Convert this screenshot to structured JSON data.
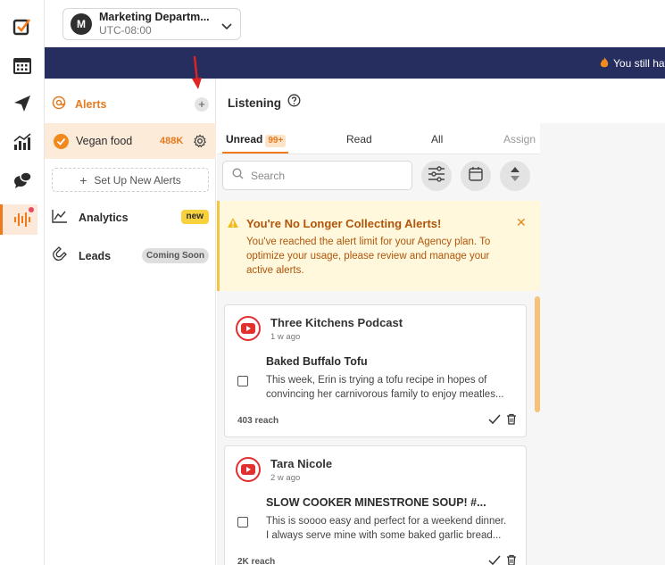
{
  "workspace": {
    "avatar": "M",
    "name": "Marketing Departm...",
    "timezone": "UTC-08:00"
  },
  "banner": {
    "text": "You still hav"
  },
  "sidebar": {
    "alerts_label": "Alerts",
    "alert_item": {
      "label": "Vegan food",
      "count": "488K"
    },
    "setup_label": "Set Up New Alerts",
    "analytics_label": "Analytics",
    "analytics_badge": "new",
    "leads_label": "Leads",
    "leads_badge": "Coming Soon"
  },
  "listening": {
    "title": "Listening"
  },
  "tabs": {
    "unread": "Unread",
    "unread_count": "99+",
    "read": "Read",
    "all": "All",
    "assign": "Assign"
  },
  "search": {
    "placeholder": "Search"
  },
  "warning": {
    "title": "You're No Longer Collecting Alerts!",
    "body": "You've reached the alert limit for your Agency plan. To optimize your usage, please review and manage your active alerts."
  },
  "cards": [
    {
      "source": "Three Kitchens Podcast",
      "time": "1 w ago",
      "title": "Baked Buffalo Tofu",
      "body_line1": "This week, Erin is trying a tofu recipe in hopes of",
      "body_line2": "convincing her carnivorous family to enjoy meatles...",
      "reach": "403 reach"
    },
    {
      "source": "Tara Nicole",
      "time": "2 w ago",
      "title": "SLOW COOKER MINESTRONE SOUP! #...",
      "body_line1": "This is soooo easy and perfect for a weekend dinner.",
      "body_line2": "I always serve mine with some baked garlic bread...",
      "reach": "2K reach"
    }
  ],
  "colors": {
    "accent": "#f07a1a",
    "banner": "#252e5f",
    "warning_bg": "#fff8dc",
    "warning_text": "#b0550a"
  }
}
